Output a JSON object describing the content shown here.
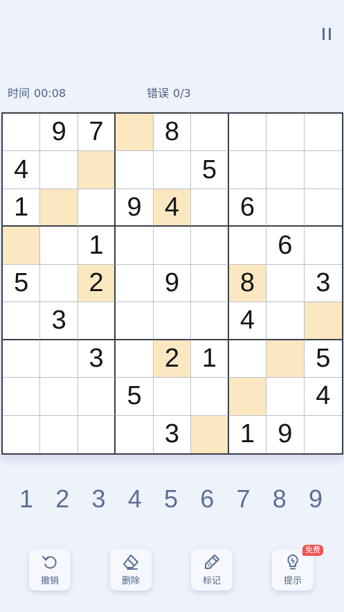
{
  "status": {
    "time_label": "时间",
    "time_value": "00:08",
    "errors_label": "错误",
    "errors_value": "0/3"
  },
  "board": {
    "rows": [
      [
        "",
        "9",
        "7",
        "",
        "8",
        "",
        "",
        "",
        ""
      ],
      [
        "4",
        "",
        "",
        "",
        "",
        "5",
        "",
        "",
        ""
      ],
      [
        "1",
        "",
        "",
        "9",
        "4",
        "",
        "6",
        "",
        ""
      ],
      [
        "",
        "",
        "1",
        "",
        "",
        "",
        "",
        "6",
        ""
      ],
      [
        "5",
        "",
        "2",
        "",
        "9",
        "",
        "8",
        "",
        "3"
      ],
      [
        "",
        "3",
        "",
        "",
        "",
        "",
        "4",
        "",
        ""
      ],
      [
        "",
        "",
        "3",
        "",
        "2",
        "1",
        "",
        "",
        "5"
      ],
      [
        "",
        "",
        "",
        "5",
        "",
        "",
        "",
        "",
        "4"
      ],
      [
        "",
        "",
        "",
        "",
        "3",
        "",
        "1",
        "9",
        ""
      ]
    ],
    "highlighted": [
      [
        0,
        3
      ],
      [
        1,
        2
      ],
      [
        2,
        1
      ],
      [
        2,
        4
      ],
      [
        3,
        0
      ],
      [
        4,
        2
      ],
      [
        4,
        6
      ],
      [
        5,
        8
      ],
      [
        6,
        4
      ],
      [
        6,
        7
      ],
      [
        7,
        6
      ],
      [
        8,
        5
      ]
    ],
    "highlight_color": "#fbe7c0"
  },
  "numpad": [
    "1",
    "2",
    "3",
    "4",
    "5",
    "6",
    "7",
    "8",
    "9"
  ],
  "tools": {
    "undo": {
      "label": "撤销",
      "icon": "undo-icon"
    },
    "erase": {
      "label": "删除",
      "icon": "eraser-icon"
    },
    "note": {
      "label": "标记",
      "icon": "pencil-icon"
    },
    "hint": {
      "label": "提示",
      "icon": "lightbulb-icon",
      "badge": "免费"
    }
  },
  "colors": {
    "accent": "#5b6f94",
    "badge": "#f05454",
    "background": "#eef2fb"
  }
}
